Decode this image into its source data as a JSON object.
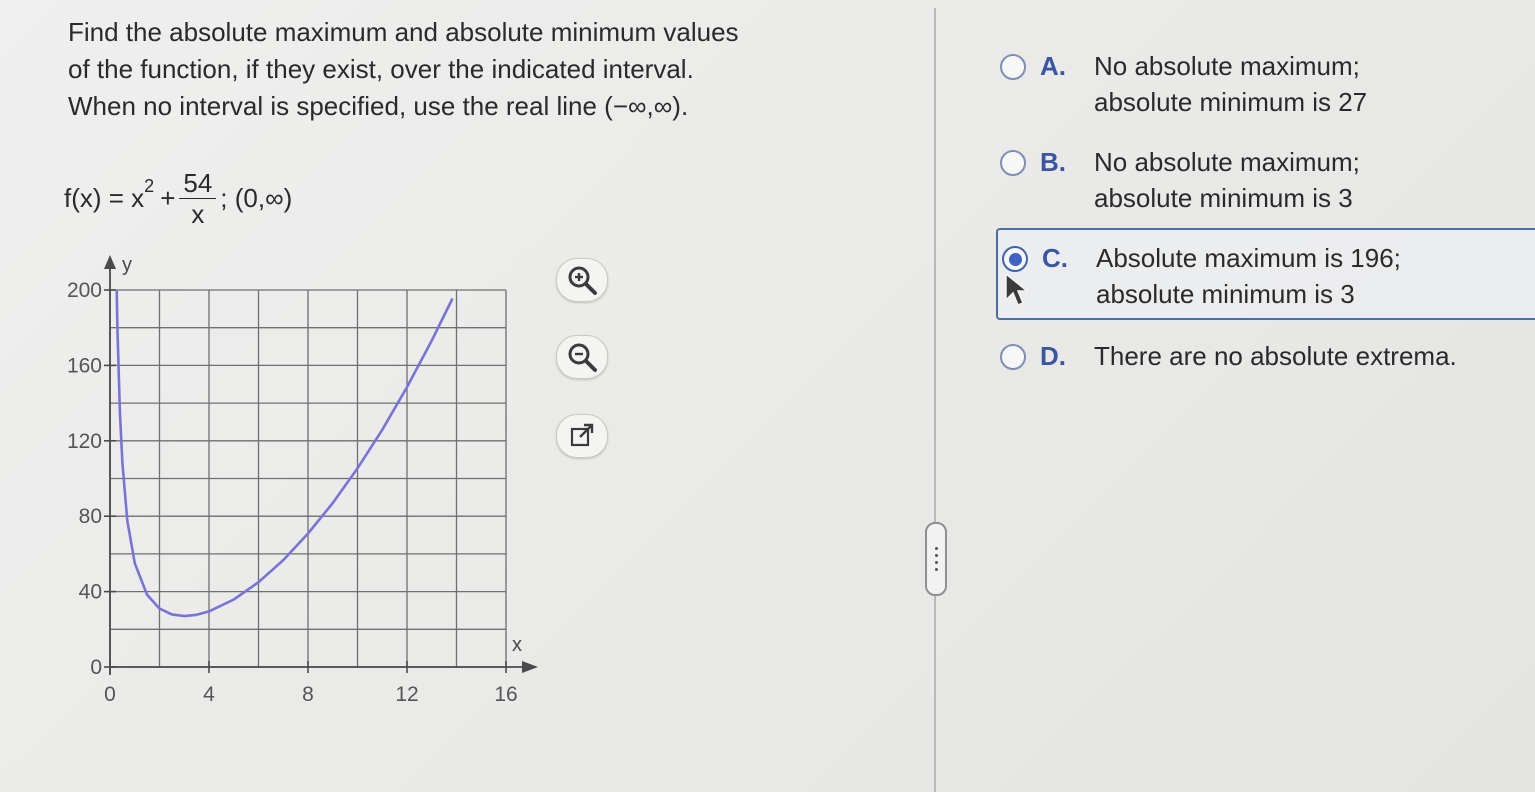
{
  "question": {
    "line1": "Find the absolute maximum and absolute minimum values",
    "line2": "of the function, if they exist, over the indicated interval.",
    "line3": "When no interval is specified, use the real line (−∞,∞)."
  },
  "formula": {
    "lhs": "f(x) = x",
    "exponent": "2",
    "plus": "+",
    "numerator": "54",
    "denominator": "x",
    "interval": "; (0,∞)"
  },
  "chart_data": {
    "type": "line",
    "function": "x^2 + 54/x",
    "x_label": "x",
    "y_label": "y",
    "xlim": [
      0,
      16
    ],
    "ylim": [
      0,
      200
    ],
    "x_ticks": [
      "0",
      "4",
      "8",
      "12",
      "16"
    ],
    "y_ticks": [
      "0",
      "40",
      "80",
      "120",
      "160",
      "200"
    ],
    "grid": true,
    "curve_color": "#7b72d6",
    "series": [
      {
        "x": [
          0.27,
          0.3,
          0.4,
          0.5,
          0.7,
          1,
          1.5,
          2,
          2.5,
          3,
          3.5,
          4,
          5,
          6,
          7,
          8,
          9,
          10,
          11,
          12,
          13,
          13.84
        ],
        "y": [
          200.1,
          180.1,
          135.2,
          108.3,
          77.6,
          55.0,
          38.3,
          31.0,
          27.9,
          27.0,
          27.7,
          29.5,
          35.8,
          45.0,
          56.7,
          70.8,
          87.0,
          105.4,
          125.9,
          148.5,
          173.2,
          195.5
        ]
      }
    ]
  },
  "tools": {
    "zoom_in": "zoom-in",
    "zoom_out": "zoom-out",
    "popout": "open-new-window"
  },
  "options": [
    {
      "letter": "A.",
      "line1": "No absolute maximum;",
      "line2": "absolute minimum is 27",
      "selected": false
    },
    {
      "letter": "B.",
      "line1": "No absolute maximum;",
      "line2": "absolute minimum is 3",
      "selected": false
    },
    {
      "letter": "C.",
      "line1": "Absolute maximum is 196;",
      "line2": "absolute minimum is 3",
      "selected": true
    },
    {
      "letter": "D.",
      "line1": "There are no absolute extrema.",
      "line2": "",
      "selected": false
    }
  ],
  "colors": {
    "accent": "#3a56a3",
    "radio_selected": "#3f63c2",
    "curve": "#7b72d6"
  }
}
